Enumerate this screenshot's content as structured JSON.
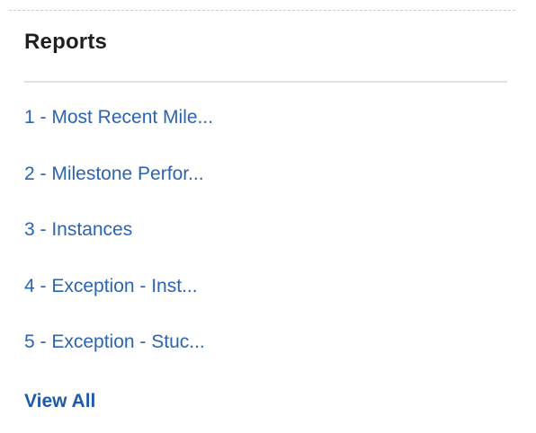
{
  "reports": {
    "title": "Reports",
    "items": [
      {
        "label": "1 - Most Recent Mile..."
      },
      {
        "label": "2 - Milestone Perfor..."
      },
      {
        "label": "3 - Instances"
      },
      {
        "label": "4 - Exception - Inst..."
      },
      {
        "label": "5 - Exception - Stuc..."
      }
    ],
    "view_all_label": "View All"
  },
  "colors": {
    "link": "#2b64b2",
    "heading": "#1f1f1f",
    "divider": "#dde2e8"
  }
}
